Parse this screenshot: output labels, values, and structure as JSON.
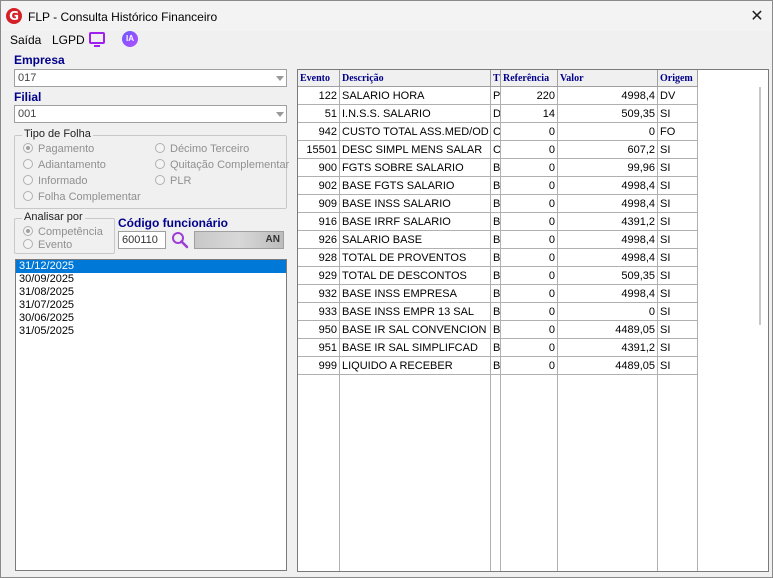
{
  "window": {
    "logo_glyph": "G",
    "title": "FLP - Consulta Histórico Financeiro",
    "close_glyph": "✕"
  },
  "menu": {
    "saida": "Saída",
    "lgpd": "LGPD",
    "ia": "IA"
  },
  "empresa": {
    "label": "Empresa",
    "value": "017"
  },
  "filial": {
    "label": "Filial",
    "value": "001"
  },
  "tipo_folha": {
    "title": "Tipo de Folha",
    "options": [
      "Pagamento",
      "Adiantamento",
      "Informado",
      "Folha Complementar",
      "Décimo Terceiro",
      "Quitação Complementar",
      "PLR"
    ],
    "selected": "Pagamento"
  },
  "analisar_por": {
    "title": "Analisar por",
    "options": [
      "Competência",
      "Evento"
    ],
    "selected": "Competência"
  },
  "funcionario": {
    "label": "Código funcionário",
    "code": "600110",
    "name_suffix": "AN"
  },
  "dates": [
    "31/12/2025",
    "30/09/2025",
    "31/08/2025",
    "31/07/2025",
    "30/06/2025",
    "31/05/2025"
  ],
  "selected_date": "31/12/2025",
  "grid": {
    "headers": [
      "Evento",
      "Descrição",
      "T",
      "Referência",
      "Valor",
      "Origem"
    ],
    "rows": [
      [
        "122",
        "SALARIO HORA",
        "P",
        "220",
        "4998,4",
        "DV"
      ],
      [
        "51",
        "I.N.S.S. SALARIO",
        "D",
        "14",
        "509,35",
        "SI"
      ],
      [
        "942",
        "CUSTO TOTAL ASS.MED/OD",
        "C",
        "0",
        "0",
        "FO"
      ],
      [
        "15501",
        "DESC SIMPL MENS SALAR",
        "C",
        "0",
        "607,2",
        "SI"
      ],
      [
        "900",
        "FGTS SOBRE SALARIO",
        "B",
        "0",
        "99,96",
        "SI"
      ],
      [
        "902",
        "BASE FGTS SALARIO",
        "B",
        "0",
        "4998,4",
        "SI"
      ],
      [
        "909",
        "BASE INSS SALARIO",
        "B",
        "0",
        "4998,4",
        "SI"
      ],
      [
        "916",
        "BASE IRRF SALARIO",
        "B",
        "0",
        "4391,2",
        "SI"
      ],
      [
        "926",
        "SALARIO BASE",
        "B",
        "0",
        "4998,4",
        "SI"
      ],
      [
        "928",
        "TOTAL DE PROVENTOS",
        "B",
        "0",
        "4998,4",
        "SI"
      ],
      [
        "929",
        "TOTAL DE DESCONTOS",
        "B",
        "0",
        "509,35",
        "SI"
      ],
      [
        "932",
        "BASE INSS EMPRESA",
        "B",
        "0",
        "4998,4",
        "SI"
      ],
      [
        "933",
        "BASE INSS EMPR 13 SAL",
        "B",
        "0",
        "0",
        "SI"
      ],
      [
        "950",
        "BASE IR SAL CONVENCION",
        "B",
        "0",
        "4489,05",
        "SI"
      ],
      [
        "951",
        "BASE IR SAL SIMPLIFCAD",
        "B",
        "0",
        "4391,2",
        "SI"
      ],
      [
        "999",
        "LIQUIDO A RECEBER",
        "B",
        "0",
        "4489,05",
        "SI"
      ]
    ]
  },
  "colors": {
    "label_blue": "#00008b",
    "selection": "#0078d7",
    "logo_red": "#d42027",
    "icon_purple": "#a020f0"
  }
}
